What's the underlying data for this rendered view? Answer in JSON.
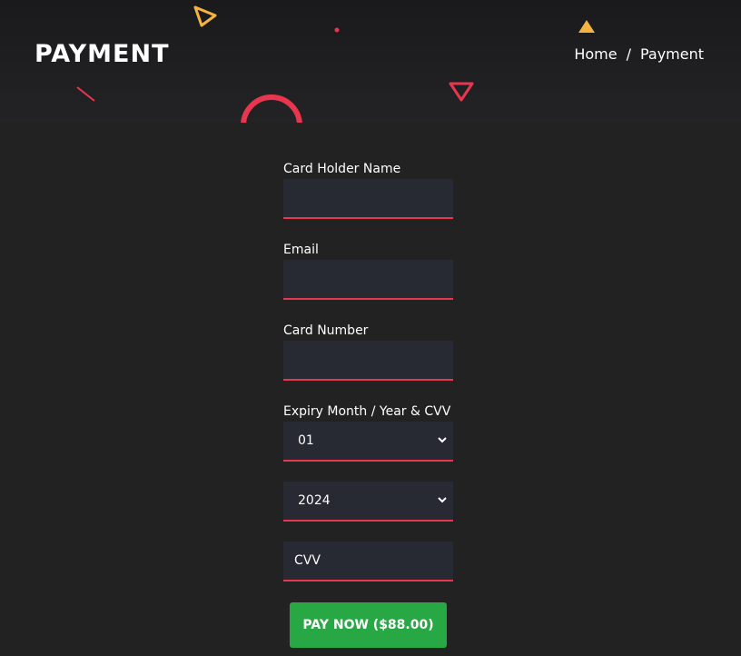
{
  "header": {
    "title": "PAYMENT",
    "breadcrumb": {
      "home": "Home",
      "separator": "/",
      "current": "Payment"
    }
  },
  "form": {
    "card_holder_label": "Card Holder Name",
    "card_holder_value": "",
    "email_label": "Email",
    "email_value": "",
    "card_number_label": "Card Number",
    "card_number_value": "",
    "expiry_label": "Expiry Month / Year & CVV",
    "month_selected": "01",
    "year_selected": "2024",
    "cvv_placeholder": "CVV",
    "pay_button_label": "PAY NOW ($88.00)"
  },
  "colors": {
    "background": "#222223",
    "header_background": "#1c1c1e",
    "input_background": "#272a33",
    "input_underline": "#e8364f",
    "pay_button": "#28a745",
    "accent_yellow": "#f5b342",
    "accent_red": "#e8364f"
  },
  "icons": [
    "triangle-outline-icon",
    "triangle-filled-icon",
    "dot-icon",
    "slash-line-icon",
    "ring-icon",
    "chevron-down-icon"
  ]
}
